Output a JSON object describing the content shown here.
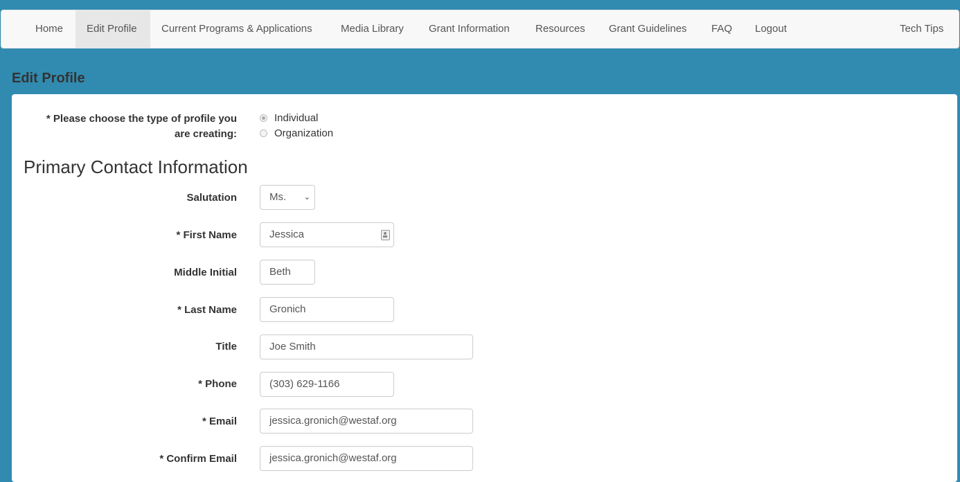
{
  "nav": {
    "items": [
      {
        "label": "Home",
        "active": false
      },
      {
        "label": "Edit Profile",
        "active": true
      },
      {
        "label": "Current Programs & Applications",
        "active": false
      },
      {
        "label": "Media Library",
        "active": false
      },
      {
        "label": "Grant Information",
        "active": false
      },
      {
        "label": "Resources",
        "active": false
      },
      {
        "label": "Grant Guidelines",
        "active": false
      },
      {
        "label": "FAQ",
        "active": false
      },
      {
        "label": "Logout",
        "active": false
      }
    ],
    "right_item": "Tech Tips"
  },
  "page": {
    "heading": "Edit Profile"
  },
  "profile_type": {
    "label_line1": "* Please choose the type of profile you",
    "label_line2": "are creating:",
    "options": [
      {
        "label": "Individual",
        "checked": true
      },
      {
        "label": "Organization",
        "checked": false
      }
    ]
  },
  "section": {
    "title": "Primary Contact Information"
  },
  "fields": {
    "salutation": {
      "label": "Salutation",
      "value": "Ms."
    },
    "first_name": {
      "label": "* First Name",
      "value": "Jessica"
    },
    "middle_initial": {
      "label": "Middle Initial",
      "value": "Beth"
    },
    "last_name": {
      "label": "* Last Name",
      "value": "Gronich"
    },
    "title": {
      "label": "Title",
      "value": "Joe Smith"
    },
    "phone": {
      "label": "* Phone",
      "value": "(303) 629-1166"
    },
    "email": {
      "label": "* Email",
      "value": "jessica.gronich@westaf.org"
    },
    "confirm_email": {
      "label": "* Confirm Email",
      "value": "jessica.gronich@westaf.org"
    }
  },
  "colors": {
    "background": "#318bb0",
    "navbar": "#f8f8f8",
    "nav_active": "#e7e7e7"
  }
}
